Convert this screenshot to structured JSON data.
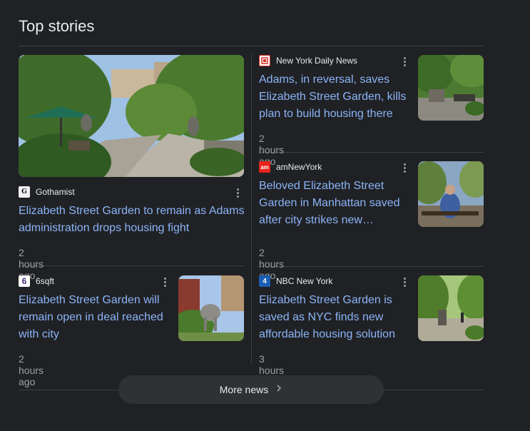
{
  "section": {
    "title": "Top stories",
    "more_label": "More news"
  },
  "stories": [
    {
      "source": "Gothamist",
      "favicon_glyph": "G",
      "headline_line1": "Elizabeth Street Garden to remain as Adams",
      "headline_line2": "administration drops housing fight",
      "time": "2 hours ago"
    },
    {
      "source": "New York Daily News",
      "favicon_glyph": "",
      "headline_line1": "Adams, in reversal, saves",
      "headline_line2": "Elizabeth Street Garden, kills",
      "headline_line3": "plan to build housing there",
      "time": "2 hours ago"
    },
    {
      "source": "amNewYork",
      "favicon_glyph": "am",
      "headline_line1": "Beloved Elizabeth Street",
      "headline_line2": "Garden in Manhattan saved",
      "headline_line3": "after city strikes new…",
      "time": "2 hours ago"
    },
    {
      "source": "6sqft",
      "favicon_glyph": "6",
      "headline_line1": "Elizabeth Street Garden will",
      "headline_line2": "remain open in deal reached",
      "headline_line3": "with city",
      "time": "2 hours ago"
    },
    {
      "source": "NBC New York",
      "favicon_glyph": "4",
      "headline_line1": "Elizabeth Street Garden is",
      "headline_line2": "saved as NYC finds new",
      "headline_line3": "affordable housing solution",
      "time": "3 hours ago"
    }
  ],
  "colors": {
    "background": "#202124",
    "headline": "#8ab4f8",
    "muted": "#9aa0a6",
    "divider": "#3c4043",
    "button": "#303134"
  },
  "icons": {
    "menu": "three-dot-vertical-icon",
    "chevron": "chevron-right-icon"
  }
}
